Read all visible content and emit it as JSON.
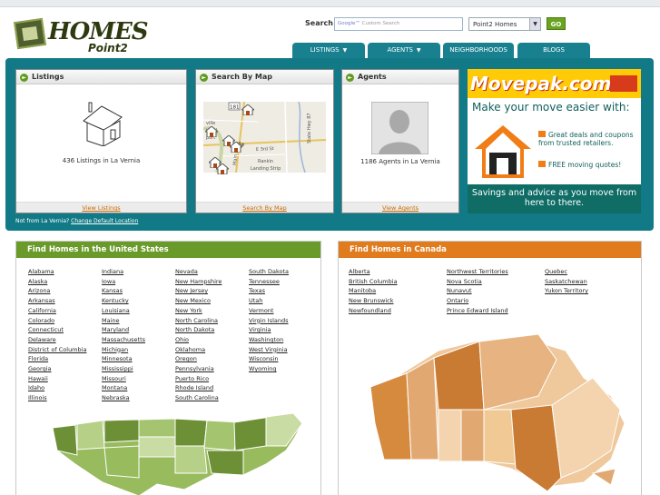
{
  "header": {
    "logo": {
      "word1": "HOMES",
      "word2": "Point2"
    },
    "search_label": "Search",
    "search_placeholder": "Custom Search",
    "search_google": "Google™",
    "site_select": "Point2 Homes",
    "go_label": "GO"
  },
  "nav": {
    "tabs": [
      {
        "label": "LISTINGS"
      },
      {
        "label": "AGENTS"
      },
      {
        "label": "NEIGHBORHOODS"
      },
      {
        "label": "BLOGS"
      }
    ]
  },
  "panels": {
    "listings": {
      "title": "Listings",
      "caption": "436 Listings in La Vernia",
      "link": "View Listings"
    },
    "map": {
      "title": "Search By Map",
      "link": "Search By Map",
      "labels": {
        "route": "181",
        "town": "ville",
        "st1": "E 3rd St",
        "st2": "Main St",
        "hwy": "State Hwy 87",
        "r1": "Rankin",
        "r2": "Landing Strip",
        "sid1": "ville",
        "sid2": "ional",
        "sid3": "port"
      }
    },
    "agents": {
      "title": "Agents",
      "caption": "1186 Agents in La Vernia",
      "link": "View Agents"
    }
  },
  "location_note": {
    "text": "Not from La Vernia?",
    "link": "Change Default Location"
  },
  "ad": {
    "brand": "Movepak.com",
    "headline": "Make your move easier with:",
    "bullets": [
      "Great deals and coupons from trusted retailers.",
      "FREE moving quotes!"
    ],
    "footer": "Savings and advice as you move from here to there."
  },
  "us": {
    "title": "Find Homes in the United States",
    "color": "#6a9a2a",
    "columns": [
      [
        "Alabama",
        "Alaska",
        "Arizona",
        "Arkansas",
        "California",
        "Colorado",
        "Connecticut",
        "Delaware",
        "District of Columbia",
        "Florida",
        "Georgia",
        "Hawaii",
        "Idaho",
        "Illinois"
      ],
      [
        "Indiana",
        "Iowa",
        "Kansas",
        "Kentucky",
        "Louisiana",
        "Maine",
        "Maryland",
        "Massachusetts",
        "Michigan",
        "Minnesota",
        "Mississippi",
        "Missouri",
        "Montana",
        "Nebraska"
      ],
      [
        "Nevada",
        "New Hampshire",
        "New Jersey",
        "New Mexico",
        "New York",
        "North Carolina",
        "North Dakota",
        "Ohio",
        "Oklahoma",
        "Oregon",
        "Pennsylvania",
        "Puerto Rico",
        "Rhode Island",
        "South Carolina"
      ],
      [
        "South Dakota",
        "Tennessee",
        "Texas",
        "Utah",
        "Vermont",
        "Virgin Islands",
        "Virginia",
        "Washington",
        "West Virginia",
        "Wisconsin",
        "Wyoming"
      ]
    ]
  },
  "ca": {
    "title": "Find Homes in Canada",
    "color": "#e07b1e",
    "columns": [
      [
        "Alberta",
        "British Columbia",
        "Manitoba",
        "New Brunswick",
        "Newfoundland"
      ],
      [
        "Northwest Territories",
        "Nova Scotia",
        "Nunavut",
        "Ontario",
        "Prince Edward Island"
      ],
      [
        "Quebec",
        "Saskatchewan",
        "Yukon Territory"
      ]
    ]
  }
}
